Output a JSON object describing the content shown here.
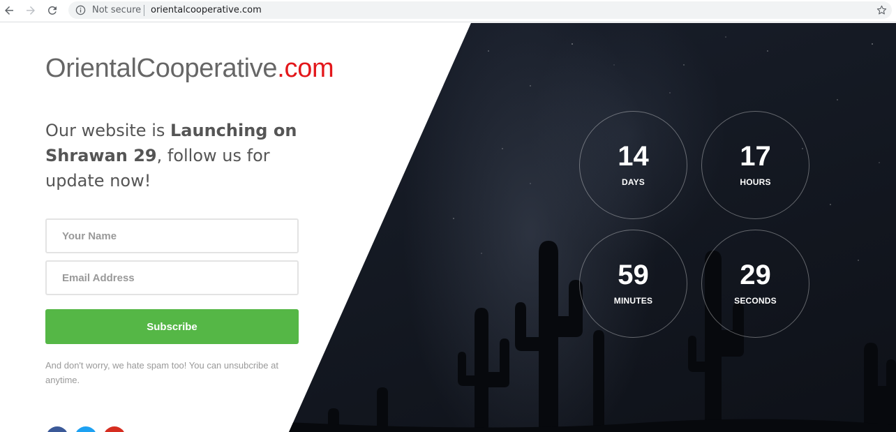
{
  "browser": {
    "security_label": "Not secure",
    "url": "orientalcooperative.com",
    "icons": [
      "back-arrow-icon",
      "forward-arrow-icon",
      "reload-icon",
      "info-icon",
      "star-icon"
    ]
  },
  "brand": {
    "name": "OrientalCooperative",
    "tld": ".com",
    "name_color": "#666666",
    "tld_color": "#e3171b"
  },
  "headline": {
    "part1": "Our website is ",
    "bold": "Launching on Shrawan 29",
    "part2": ", follow us for update now!"
  },
  "form": {
    "name_placeholder": "Your Name",
    "email_placeholder": "Email Address",
    "subscribe_label": "Subscribe",
    "subscribe_color": "#55b746",
    "note": "And don't worry, we hate spam too! You can unsubcribe at anytime."
  },
  "social": [
    {
      "name": "facebook",
      "color": "#3b5998"
    },
    {
      "name": "twitter",
      "color": "#1da1f2"
    },
    {
      "name": "google-plus",
      "color": "#d62d20"
    }
  ],
  "countdown": {
    "days": {
      "value": "14",
      "label": "DAYS"
    },
    "hours": {
      "value": "17",
      "label": "HOURS"
    },
    "minutes": {
      "value": "59",
      "label": "MINUTES"
    },
    "seconds": {
      "value": "29",
      "label": "SECONDS"
    }
  }
}
